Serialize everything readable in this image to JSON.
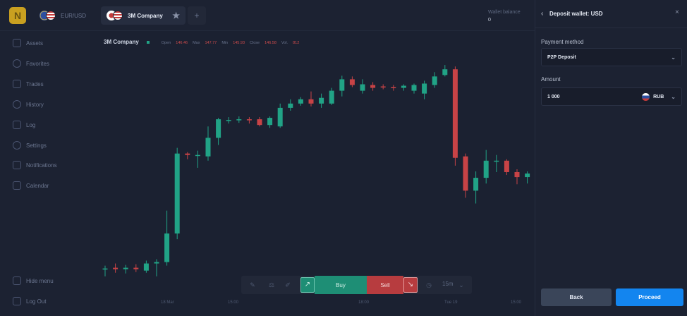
{
  "topbar": {
    "logo_letter": "N",
    "pair_label": "EUR/USD",
    "asset_tab_label": "3M Company",
    "wallet_label": "Wallet balance",
    "wallet_value": "0"
  },
  "sidebar": {
    "items": [
      {
        "label": "Assets",
        "icon": "grid-icon"
      },
      {
        "label": "Favorites",
        "icon": "heart-icon"
      },
      {
        "label": "Trades",
        "icon": "stack-icon"
      },
      {
        "label": "History",
        "icon": "clock-icon"
      },
      {
        "label": "Log",
        "icon": "chat-icon"
      },
      {
        "label": "Settings",
        "icon": "gear-icon"
      },
      {
        "label": "Notifications",
        "icon": "bell-icon"
      },
      {
        "label": "Calendar",
        "icon": "calendar-icon"
      }
    ],
    "hide_menu": "Hide menu",
    "log_out": "Log Out"
  },
  "chart": {
    "company": "3M Company",
    "open_label": "Open",
    "open_value": "146.46",
    "max_label": "Max",
    "max_value": "147.77",
    "min_label": "Min",
    "min_value": "145.93",
    "close_label": "Close",
    "close_value": "146.58",
    "vol_label": "Vol.",
    "vol_value": "812",
    "x_ticks": [
      "18 Mar",
      "15:00",
      "18:00",
      "Tue 19",
      "15:00"
    ]
  },
  "trade_bar": {
    "buy_label": "Buy",
    "sell_label": "Sell",
    "timeframe": "15m"
  },
  "panel": {
    "title": "Deposit wallet: USD",
    "payment_method_label": "Payment method",
    "payment_method_value": "P2P Deposit",
    "amount_label": "Amount",
    "amount_value": "1 000",
    "currency": "RUB",
    "back_label": "Back",
    "proceed_label": "Proceed"
  },
  "colors": {
    "up": "#21a386",
    "down": "#c84346",
    "accent": "#1385ef"
  },
  "candles": [
    {
      "o": 146.2,
      "h": 146.25,
      "l": 146.1,
      "c": 146.21
    },
    {
      "o": 146.22,
      "h": 146.28,
      "l": 146.15,
      "c": 146.2
    },
    {
      "o": 146.2,
      "h": 146.26,
      "l": 146.14,
      "c": 146.22
    },
    {
      "o": 146.22,
      "h": 146.27,
      "l": 146.16,
      "c": 146.2
    },
    {
      "o": 146.18,
      "h": 146.32,
      "l": 146.15,
      "c": 146.28
    },
    {
      "o": 146.28,
      "h": 146.34,
      "l": 146.1,
      "c": 146.3
    },
    {
      "o": 146.3,
      "h": 147.02,
      "l": 146.25,
      "c": 146.7
    },
    {
      "o": 146.7,
      "h": 147.9,
      "l": 146.62,
      "c": 147.82
    },
    {
      "o": 147.82,
      "h": 147.84,
      "l": 147.74,
      "c": 147.8
    },
    {
      "o": 147.8,
      "h": 147.86,
      "l": 147.62,
      "c": 147.8
    },
    {
      "o": 147.78,
      "h": 148.2,
      "l": 147.72,
      "c": 148.04
    },
    {
      "o": 148.04,
      "h": 148.32,
      "l": 147.94,
      "c": 148.3
    },
    {
      "o": 148.28,
      "h": 148.33,
      "l": 148.24,
      "c": 148.29
    },
    {
      "o": 148.29,
      "h": 148.34,
      "l": 148.25,
      "c": 148.3
    },
    {
      "o": 148.3,
      "h": 148.33,
      "l": 148.24,
      "c": 148.29
    },
    {
      "o": 148.3,
      "h": 148.33,
      "l": 148.2,
      "c": 148.22
    },
    {
      "o": 148.22,
      "h": 148.34,
      "l": 148.18,
      "c": 148.32
    },
    {
      "o": 148.2,
      "h": 148.52,
      "l": 148.18,
      "c": 148.46
    },
    {
      "o": 148.46,
      "h": 148.58,
      "l": 148.42,
      "c": 148.52
    },
    {
      "o": 148.52,
      "h": 148.61,
      "l": 148.49,
      "c": 148.58
    },
    {
      "o": 148.58,
      "h": 148.69,
      "l": 148.48,
      "c": 148.52
    },
    {
      "o": 148.52,
      "h": 148.66,
      "l": 148.46,
      "c": 148.6
    },
    {
      "o": 148.52,
      "h": 148.74,
      "l": 148.5,
      "c": 148.7
    },
    {
      "o": 148.7,
      "h": 148.91,
      "l": 148.62,
      "c": 148.86
    },
    {
      "o": 148.86,
      "h": 148.9,
      "l": 148.75,
      "c": 148.78
    },
    {
      "o": 148.7,
      "h": 148.86,
      "l": 148.66,
      "c": 148.79
    },
    {
      "o": 148.78,
      "h": 148.82,
      "l": 148.7,
      "c": 148.74
    },
    {
      "o": 148.76,
      "h": 148.79,
      "l": 148.72,
      "c": 148.75
    },
    {
      "o": 148.75,
      "h": 148.78,
      "l": 148.7,
      "c": 148.74
    },
    {
      "o": 148.74,
      "h": 148.79,
      "l": 148.7,
      "c": 148.77
    },
    {
      "o": 148.7,
      "h": 148.8,
      "l": 148.66,
      "c": 148.78
    },
    {
      "o": 148.66,
      "h": 148.84,
      "l": 148.58,
      "c": 148.8
    },
    {
      "o": 148.78,
      "h": 148.96,
      "l": 148.74,
      "c": 148.9
    },
    {
      "o": 148.92,
      "h": 149.06,
      "l": 148.9,
      "c": 149.0
    },
    {
      "o": 149.0,
      "h": 149.04,
      "l": 147.65,
      "c": 147.76
    },
    {
      "o": 147.78,
      "h": 147.82,
      "l": 147.2,
      "c": 147.3
    },
    {
      "o": 147.3,
      "h": 147.57,
      "l": 147.12,
      "c": 147.48
    },
    {
      "o": 147.48,
      "h": 147.87,
      "l": 147.4,
      "c": 147.72
    },
    {
      "o": 147.72,
      "h": 147.8,
      "l": 147.56,
      "c": 147.72
    },
    {
      "o": 147.72,
      "h": 147.74,
      "l": 147.52,
      "c": 147.56
    },
    {
      "o": 147.56,
      "h": 147.6,
      "l": 147.39,
      "c": 147.49
    },
    {
      "o": 147.49,
      "h": 147.57,
      "l": 147.4,
      "c": 147.54
    }
  ]
}
